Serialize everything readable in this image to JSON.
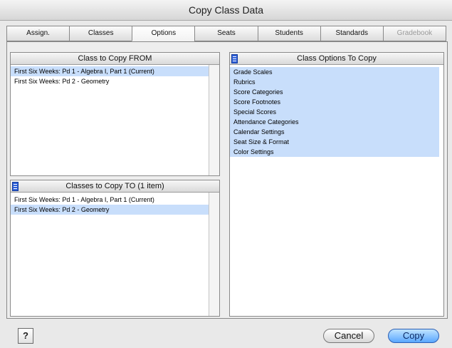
{
  "window": {
    "title": "Copy Class Data"
  },
  "tabs": [
    {
      "label": "Assign."
    },
    {
      "label": "Classes"
    },
    {
      "label": "Options"
    },
    {
      "label": "Seats"
    },
    {
      "label": "Students"
    },
    {
      "label": "Standards"
    },
    {
      "label": "Gradebook"
    }
  ],
  "from_panel": {
    "header": "Class to Copy FROM",
    "items": [
      {
        "label": "First Six Weeks: Pd 1 - Algebra I, Part 1 (Current)",
        "selected": true
      },
      {
        "label": "First Six Weeks: Pd 2 - Geometry",
        "selected": false
      }
    ]
  },
  "to_panel": {
    "header": "Classes to Copy TO  (1 item)",
    "items": [
      {
        "label": "First Six Weeks: Pd 1 - Algebra I, Part 1 (Current)",
        "selected": false
      },
      {
        "label": "First Six Weeks: Pd 2 - Geometry",
        "selected": true
      }
    ]
  },
  "options_panel": {
    "header": "Class Options To Copy",
    "items": [
      {
        "label": "Grade Scales",
        "selected": true
      },
      {
        "label": "Rubrics",
        "selected": true
      },
      {
        "label": "Score Categories",
        "selected": true
      },
      {
        "label": "Score Footnotes",
        "selected": true
      },
      {
        "label": "Special Scores",
        "selected": true
      },
      {
        "label": "Attendance Categories",
        "selected": true
      },
      {
        "label": "Calendar Settings",
        "selected": true
      },
      {
        "label": "Seat Size & Format",
        "selected": true
      },
      {
        "label": "Color Settings",
        "selected": true
      }
    ]
  },
  "footer": {
    "help_label": "?",
    "cancel_label": "Cancel",
    "copy_label": "Copy"
  },
  "colors": {
    "selection": "#c8defb",
    "default_button": "#5aa7ff"
  }
}
